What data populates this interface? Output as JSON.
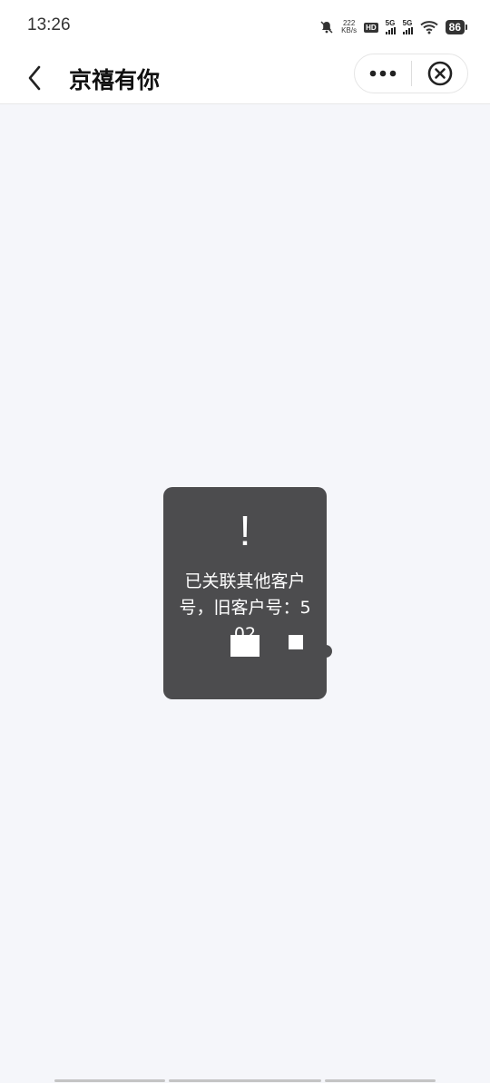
{
  "status_bar": {
    "time": "13:26",
    "speed_value": "222",
    "speed_unit": "KB/s",
    "hd_label": "HD",
    "signal1_label": "5G",
    "signal2_label": "5G",
    "battery": "86",
    "icons": [
      "mute-bell-icon",
      "hd-icon",
      "signal-icon",
      "signal-icon",
      "wifi-icon",
      "battery-icon"
    ]
  },
  "nav": {
    "title": "京禧有你",
    "back_icon": "chevron-left-icon",
    "more_icon": "more-dots-icon",
    "close_icon": "close-circle-icon"
  },
  "toast": {
    "icon_text": "!",
    "message": "已关联其他客户号，旧客户号：5",
    "message_suffix": "02"
  },
  "colors": {
    "page_bg": "#f5f6fa",
    "toast_bg": "#4c4c4e",
    "nav_bg": "#ffffff"
  }
}
